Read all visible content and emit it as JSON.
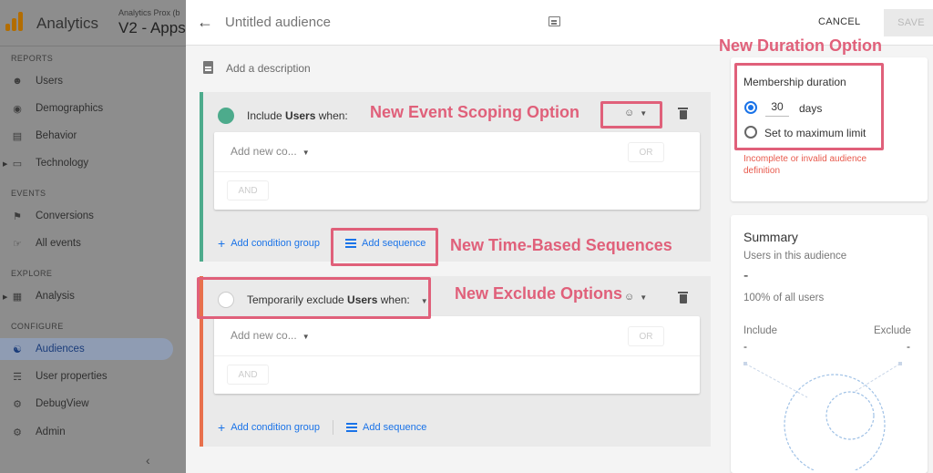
{
  "nav": {
    "app_name": "Analytics",
    "account_sub": "Analytics Prox (b",
    "account_name": "V2 - Apps",
    "sections": {
      "reports": "REPORTS",
      "events": "EVENTS",
      "explore": "EXPLORE",
      "configure": "CONFIGURE"
    },
    "items": [
      {
        "label": "Users",
        "icon": "person-icon"
      },
      {
        "label": "Demographics",
        "icon": "globe-icon"
      },
      {
        "label": "Behavior",
        "icon": "behavior-icon"
      },
      {
        "label": "Technology",
        "icon": "technology-icon"
      },
      {
        "label": "Conversions",
        "icon": "flag-icon"
      },
      {
        "label": "All events",
        "icon": "touch-icon"
      },
      {
        "label": "Analysis",
        "icon": "analysis-icon"
      },
      {
        "label": "Audiences",
        "icon": "audiences-icon"
      },
      {
        "label": "User properties",
        "icon": "user-properties-icon"
      },
      {
        "label": "DebugView",
        "icon": "debug-icon"
      },
      {
        "label": "Admin",
        "icon": "gear-icon"
      }
    ],
    "collapse": "‹"
  },
  "header": {
    "back": "←",
    "title": "Untitled audience",
    "cancel": "CANCEL",
    "save": "SAVE"
  },
  "description_placeholder": "Add a description",
  "include_group": {
    "prefix": "Include ",
    "bold": "Users",
    "suffix": " when:",
    "add_condition": "Add new co...",
    "or": "OR",
    "and": "AND",
    "add_condition_group": "Add condition group",
    "add_sequence": "Add sequence"
  },
  "exclude_group": {
    "prefix": "Temporarily exclude ",
    "bold": "Users",
    "suffix": " when:",
    "add_condition": "Add new co...",
    "or": "OR",
    "and": "AND",
    "add_condition_group": "Add condition group",
    "add_sequence": "Add sequence"
  },
  "duration": {
    "title": "Membership duration",
    "days_value": "30",
    "days_unit": "days",
    "max_label": "Set to maximum limit",
    "error": "Incomplete or invalid audience definition"
  },
  "summary": {
    "title": "Summary",
    "users_label": "Users in this audience",
    "users_value": "-",
    "pct": "100% of all users",
    "include_label": "Include",
    "include_value": "-",
    "exclude_label": "Exclude",
    "exclude_value": "-"
  },
  "annotations": {
    "duration": "New Duration Option",
    "event_scoping": "New Event Scoping Option",
    "sequences": "New Time-Based Sequences",
    "exclude": "New Exclude Options"
  },
  "colors": {
    "annotation": "#e0607a",
    "include_accent": "#4dab8c",
    "exclude_accent": "#e8704c",
    "link_blue": "#1a73e8"
  }
}
